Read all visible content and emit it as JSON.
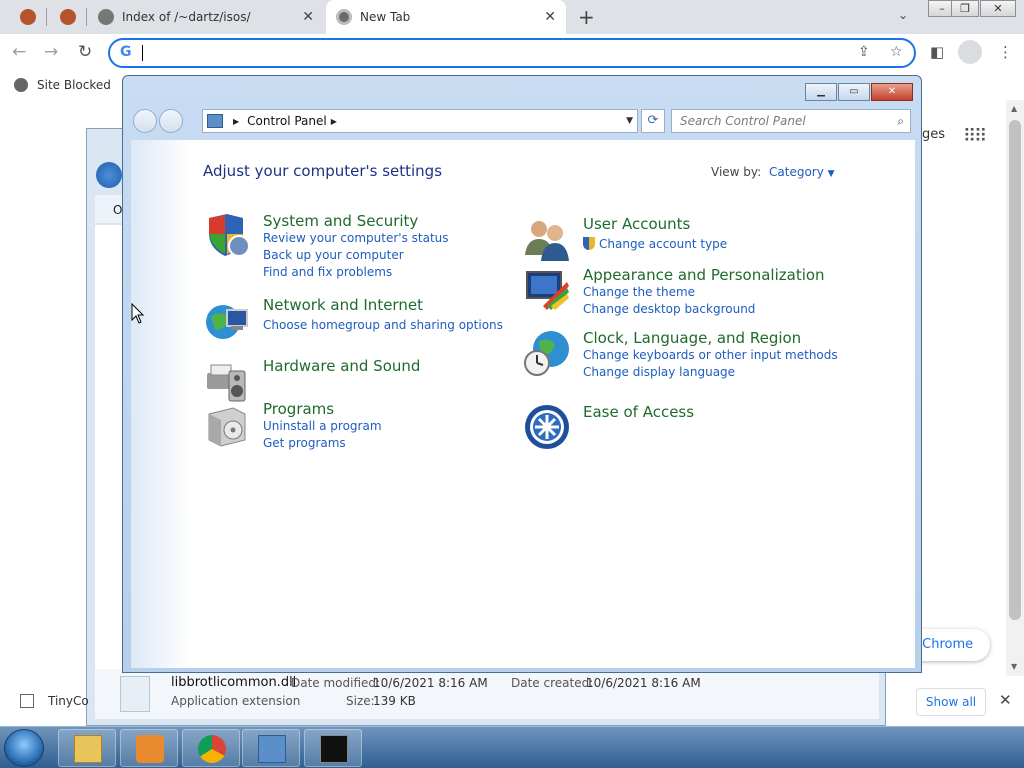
{
  "browser": {
    "tabs": [
      {
        "title": ""
      },
      {
        "title": ""
      },
      {
        "title": "Index of /~dartz/isos/"
      },
      {
        "title": "New Tab"
      }
    ],
    "bookmark": "Site Blocked",
    "omnibox_value": ""
  },
  "page": {
    "right_text": "ges",
    "chrome_pill": "e Chrome"
  },
  "explorer": {
    "file_name": "libbrotlicommon.dll",
    "file_type": "Application extension",
    "date_modified_label": "Date modified:",
    "date_modified": "10/6/2021 8:16 AM",
    "date_created_label": "Date created:",
    "date_created": "10/6/2021 8:16 AM",
    "size_label": "Size:",
    "size": "139 KB",
    "side_label": "O"
  },
  "download_bar": {
    "item": "TinyCo",
    "show_all": "Show all"
  },
  "control_panel": {
    "address": "Control Panel",
    "search_placeholder": "Search Control Panel",
    "title": "Adjust your computer's settings",
    "view_by_label": "View by:",
    "view_by_value": "Category",
    "left_categories": [
      {
        "name": "System and Security",
        "links": [
          "Review your computer's status",
          "Back up your computer",
          "Find and fix problems"
        ]
      },
      {
        "name": "Network and Internet",
        "links": [
          "Choose homegroup and sharing options"
        ]
      },
      {
        "name": "Hardware and Sound",
        "links": []
      },
      {
        "name": "Programs",
        "links": [
          "Uninstall a program",
          "Get programs"
        ]
      }
    ],
    "right_categories": [
      {
        "name": "User Accounts",
        "links": [
          "Change account type"
        ]
      },
      {
        "name": "Appearance and Personalization",
        "links": [
          "Change the theme",
          "Change desktop background"
        ]
      },
      {
        "name": "Clock, Language, and Region",
        "links": [
          "Change keyboards or other input methods",
          "Change display language"
        ]
      },
      {
        "name": "Ease of Access",
        "links": []
      }
    ]
  },
  "colors": {
    "accent": "#1a73e8",
    "cp_link": "#1e5dbf",
    "cp_heading": "#1e6b2c",
    "cp_title": "#1e3287"
  }
}
